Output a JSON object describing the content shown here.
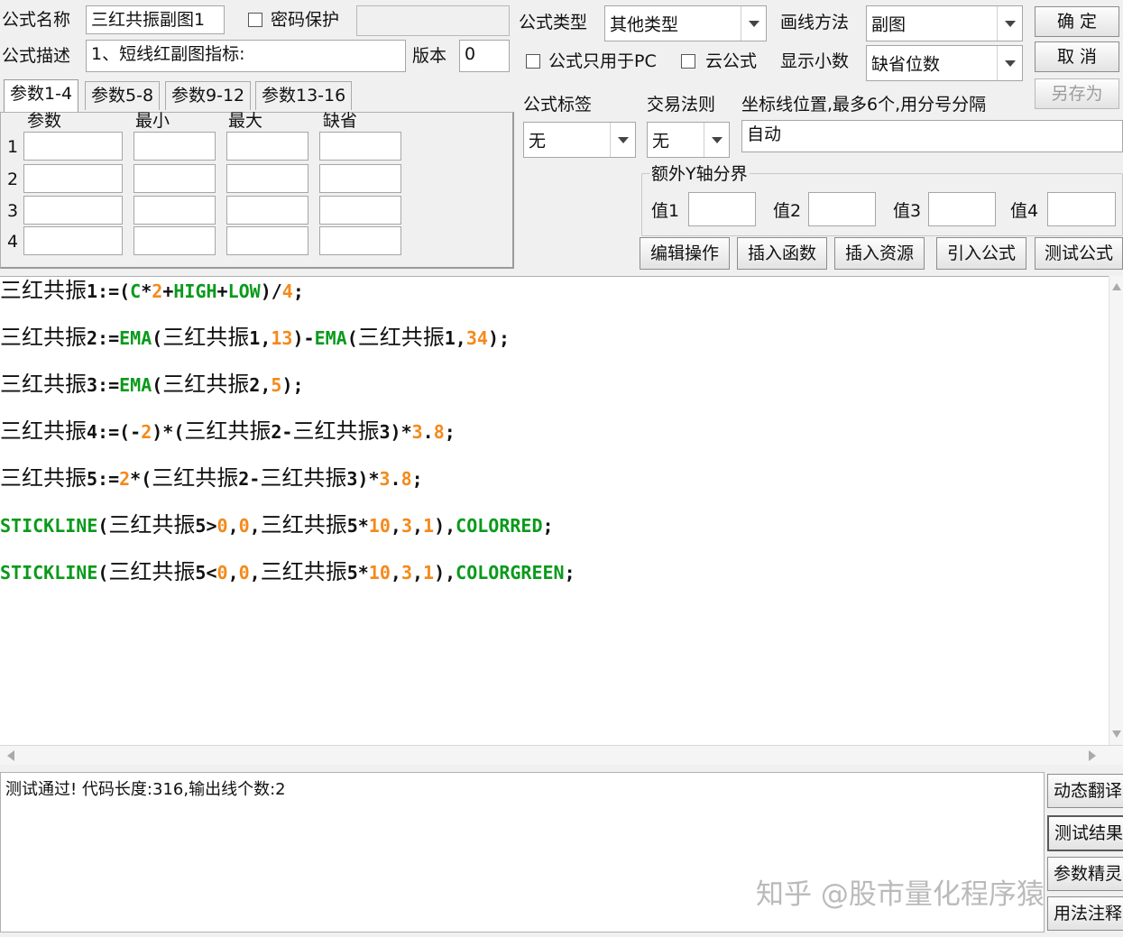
{
  "header": {
    "name_label": "公式名称",
    "name_value": "三红共振副图1",
    "password_label": "密码保护",
    "desc_label": "公式描述",
    "desc_value": "1、短线红副图指标:",
    "version_label": "版本",
    "version_value": "0",
    "type_label": "公式类型",
    "type_value": "其他类型",
    "draw_label": "画线方法",
    "draw_value": "副图",
    "pc_only_label": "公式只用于PC",
    "cloud_label": "云公式",
    "decimal_label": "显示小数",
    "decimal_value": "缺省位数"
  },
  "buttons": {
    "ok": "确  定",
    "cancel": "取  消",
    "save_as": "另存为"
  },
  "param_tabs": [
    "参数1-4",
    "参数5-8",
    "参数9-12",
    "参数13-16"
  ],
  "param_headers": [
    "参数",
    "最小",
    "最大",
    "缺省"
  ],
  "param_rows": [
    "1",
    "2",
    "3",
    "4"
  ],
  "tags": {
    "tag_label": "公式标签",
    "tag_value": "无",
    "rule_label": "交易法则",
    "rule_value": "无",
    "axis_label": "坐标线位置,最多6个,用分号分隔",
    "axis_value": "自动"
  },
  "y_axis": {
    "group_label": "额外Y轴分界",
    "v1": "值1",
    "v2": "值2",
    "v3": "值3",
    "v4": "值4"
  },
  "actions": [
    "编辑操作",
    "插入函数",
    "插入资源",
    "引入公式",
    "测试公式"
  ],
  "code": {
    "l1_name": "三红共振",
    "l1_a": "1:=(",
    "l1_b": "C",
    "l1_c": "*",
    "l1_d": "2",
    "l1_e": "+",
    "l1_f": "HIGH",
    "l1_g": "+",
    "l1_h": "LOW",
    "l1_i": ")/",
    "l1_j": "4",
    "l1_k": ";",
    "l2_name": "三红共振",
    "l2_a": "2:=",
    "l2_b": "EMA",
    "l2_c": "(",
    "l2_d": "三红共振",
    "l2_e": "1,",
    "l2_f": "13",
    "l2_g": ")-",
    "l2_h": "EMA",
    "l2_i": "(",
    "l2_j": "三红共振",
    "l2_k": "1,",
    "l2_l": "34",
    "l2_m": ");",
    "l3_name": "三红共振",
    "l3_a": "3:=",
    "l3_b": "EMA",
    "l3_c": "(",
    "l3_d": "三红共振",
    "l3_e": "2,",
    "l3_f": "5",
    "l3_g": ");",
    "l4_name": "三红共振",
    "l4_a": "4:=(-",
    "l4_b": "2",
    "l4_c": ")*(",
    "l4_d": "三红共振",
    "l4_e": "2-",
    "l4_f": "三红共振",
    "l4_g": "3)*",
    "l4_h": "3",
    "l4_i": ".",
    "l4_j": "8",
    "l4_k": ";",
    "l5_name": "三红共振",
    "l5_a": "5:=",
    "l5_b": "2",
    "l5_c": "*(",
    "l5_d": "三红共振",
    "l5_e": "2-",
    "l5_f": "三红共振",
    "l5_g": "3)*",
    "l5_h": "3",
    "l5_i": ".",
    "l5_j": "8",
    "l5_k": ";",
    "l6_a": "STICKLINE",
    "l6_b": "(",
    "l6_c": "三红共振",
    "l6_d": "5>",
    "l6_e": "0",
    "l6_f": ",",
    "l6_g": "0",
    "l6_h": ",",
    "l6_i": "三红共振",
    "l6_j": "5*",
    "l6_k": "10",
    "l6_l": ",",
    "l6_m": "3",
    "l6_n": ",",
    "l6_o": "1",
    "l6_p": "),",
    "l6_q": "COLORRED",
    "l6_r": ";",
    "l7_a": "STICKLINE",
    "l7_b": "(",
    "l7_c": "三红共振",
    "l7_d": "5<",
    "l7_e": "0",
    "l7_f": ",",
    "l7_g": "0",
    "l7_h": ",",
    "l7_i": "三红共振",
    "l7_j": "5*",
    "l7_k": "10",
    "l7_l": ",",
    "l7_m": "3",
    "l7_n": ",",
    "l7_o": "1",
    "l7_p": "),",
    "l7_q": "COLORGREEN",
    "l7_r": ";"
  },
  "output": {
    "message": "测试通过! 代码长度:316,输出线个数:2"
  },
  "side_buttons": [
    "动态翻译",
    "测试结果",
    "参数精灵",
    "用法注释"
  ],
  "watermark": "知乎 @股市量化程序猿",
  "colors": {
    "function_green": "#0a9a1b",
    "number_orange": "#f5891a"
  }
}
